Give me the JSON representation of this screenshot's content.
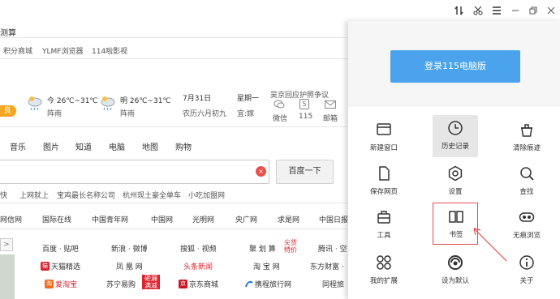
{
  "window": {
    "controls": [
      "speed-icon",
      "cut-icon",
      "menu-icon",
      "minimize-icon",
      "restore-icon",
      "close-icon"
    ],
    "title_fragment": "测算"
  },
  "favorites_bar": {
    "items": [
      "积分商城",
      "YLMF浏览器",
      "114啦影视"
    ]
  },
  "weather": {
    "quality_badge": "良",
    "today": {
      "label": "今 26℃~31℃",
      "cond": "阵雨"
    },
    "tomorrow": {
      "label": "明 26℃~31℃",
      "cond": "阵雨"
    },
    "date": "7月31日",
    "lunar": "农历六月初九",
    "weekday": "星期一",
    "suit": "宜:嫁",
    "service": "吴京回应护照争议",
    "weixin": "微信",
    "tel": "115",
    "mail": "邮箱",
    "tel_icon": "5"
  },
  "search_tabs": [
    "音乐",
    "图片",
    "知道",
    "电脑",
    "地图",
    "购物"
  ],
  "search": {
    "value": "",
    "clear": "×",
    "button": "百度一下",
    "hot": [
      "快",
      "上网就上",
      "宝鸡最长名称公司",
      "杭州现土豪全单车",
      "小吃加盟网"
    ]
  },
  "sitebar": [
    "网信网",
    "国际在线",
    "中国青年网",
    "中国网",
    "光明网",
    "央广网",
    "求是网",
    "中国日报"
  ],
  "sites": [
    [
      "百度 · 贴吧",
      "新浪 · 微博",
      "搜狐 · 视频",
      "聚 划 算",
      "腾讯 · 空"
    ],
    [
      "天猫精选",
      "凤 凰 网",
      "头条新闻",
      "淘 宝 网",
      "东方财富 ·"
    ],
    [
      "爱淘宝",
      "苏宁易购",
      "京东商城",
      "携程旅行网",
      "同程旅"
    ]
  ],
  "site_badges": {
    "juhuasuan": "尖货特价",
    "suning": "砸漏满减",
    "jd": "京",
    "tmall": "猫",
    "aitaobao": "淘"
  },
  "left_scroll": ">",
  "panel": {
    "login": "登录115电脑版",
    "tiles": [
      {
        "label": "新建窗口",
        "icon": "new-window-icon"
      },
      {
        "label": "历史记录",
        "icon": "history-icon"
      },
      {
        "label": "清除痕迹",
        "icon": "clear-trace-icon"
      },
      {
        "label": "保存网页",
        "icon": "save-page-icon"
      },
      {
        "label": "设置",
        "icon": "settings-icon"
      },
      {
        "label": "查找",
        "icon": "find-icon"
      },
      {
        "label": "工具",
        "icon": "tools-icon"
      },
      {
        "label": "书签",
        "icon": "bookmark-icon"
      },
      {
        "label": "无痕浏览",
        "icon": "incognito-icon"
      },
      {
        "label": "我的扩展",
        "icon": "extensions-icon"
      },
      {
        "label": "设为默认",
        "icon": "set-default-icon"
      },
      {
        "label": "关于",
        "icon": "about-icon"
      }
    ]
  },
  "colors": {
    "accent": "#4aa3ec",
    "highlight_border": "#e34b4b",
    "badge": "#f5a623",
    "hot_red": "#d9232e"
  }
}
